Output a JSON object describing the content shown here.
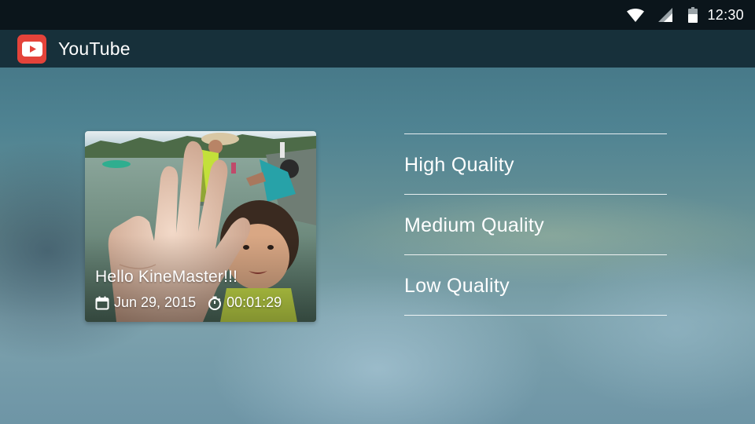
{
  "status_bar": {
    "time": "12:30",
    "icons": [
      "wifi-icon",
      "signal-icon",
      "battery-icon"
    ]
  },
  "app_bar": {
    "title": "YouTube",
    "logo_icon": "youtube-play-icon",
    "logo_color": "#e4433a"
  },
  "video": {
    "title": "Hello KineMaster!!!",
    "date": "Jun 29, 2015",
    "duration": "00:01:29",
    "date_icon": "calendar-icon",
    "duration_icon": "stopwatch-icon"
  },
  "quality_options": [
    {
      "label": "High Quality"
    },
    {
      "label": "Medium Quality"
    },
    {
      "label": "Low Quality"
    }
  ]
}
